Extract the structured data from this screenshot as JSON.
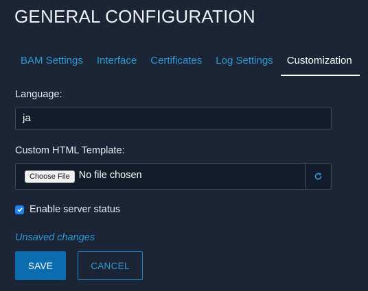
{
  "page": {
    "title": "GENERAL CONFIGURATION"
  },
  "tabs": [
    {
      "label": "BAM Settings",
      "active": false
    },
    {
      "label": "Interface",
      "active": false
    },
    {
      "label": "Certificates",
      "active": false
    },
    {
      "label": "Log Settings",
      "active": false
    },
    {
      "label": "Customization",
      "active": true
    }
  ],
  "form": {
    "language": {
      "label": "Language:",
      "value": "ja"
    },
    "template": {
      "label": "Custom HTML Template:",
      "choose_label": "Choose File",
      "status": "No file chosen",
      "refresh_icon": "refresh-icon"
    },
    "server_status": {
      "label": "Enable server status",
      "checked": true
    }
  },
  "status": {
    "unsaved": "Unsaved changes"
  },
  "actions": {
    "save": "SAVE",
    "cancel": "CANCEL"
  },
  "colors": {
    "background": "#1b2536",
    "accent": "#2e9ad6",
    "primary_button": "#0b6cb0",
    "checkbox": "#1c84f2"
  }
}
